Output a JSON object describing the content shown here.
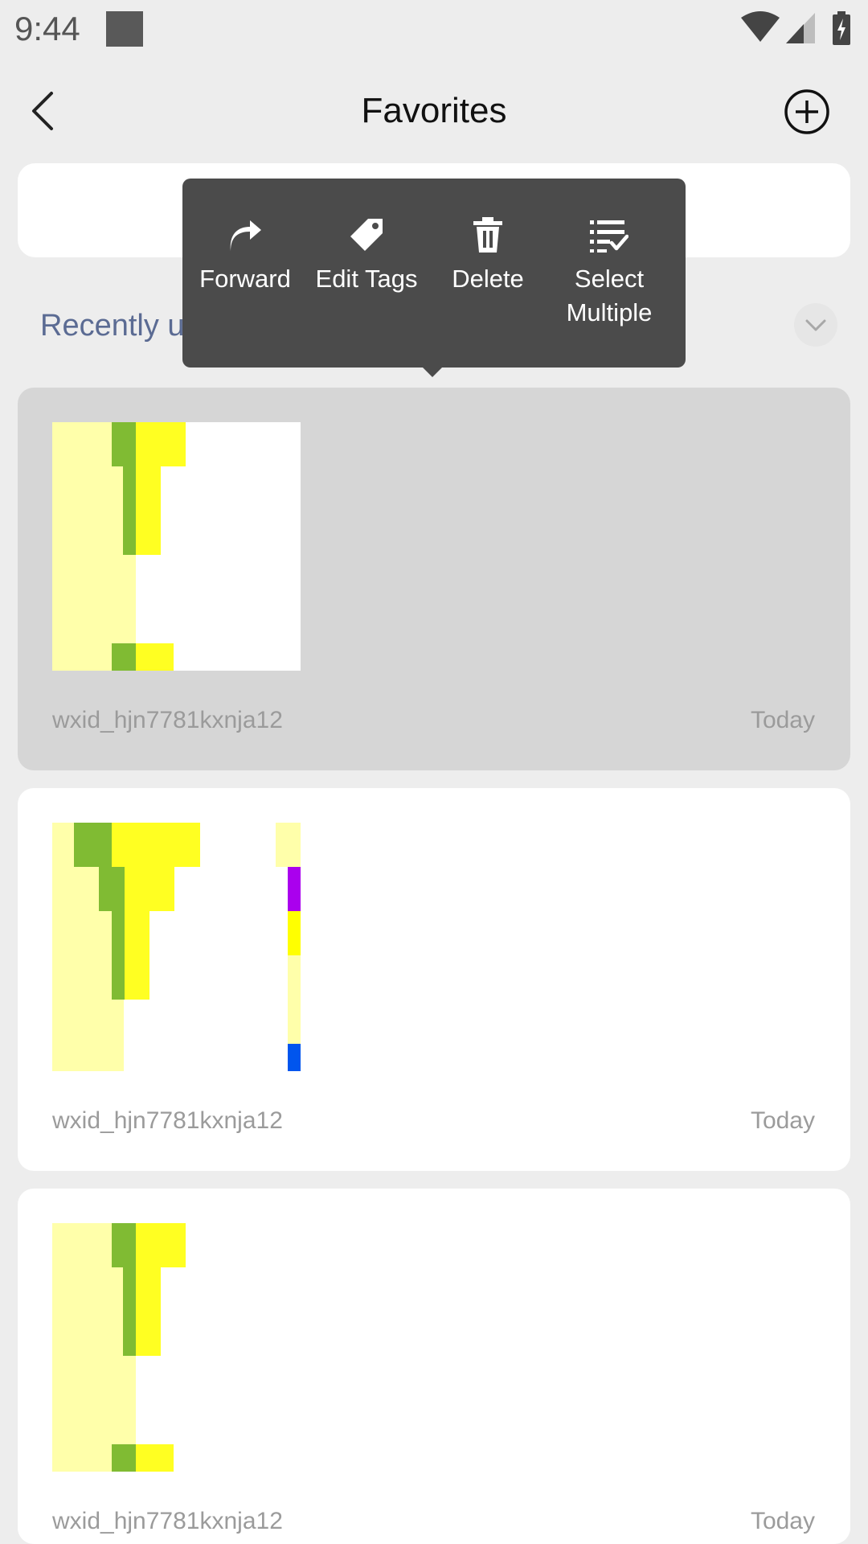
{
  "status_bar": {
    "time": "9:44"
  },
  "header": {
    "title": "Favorites"
  },
  "section": {
    "recently_used_label": "Recently used"
  },
  "context_menu": {
    "items": [
      {
        "label": "Forward",
        "icon": "forward-arrow-icon"
      },
      {
        "label": "Edit Tags",
        "icon": "tag-icon"
      },
      {
        "label": "Delete",
        "icon": "trash-icon"
      },
      {
        "label": "Select\nMultiple",
        "icon": "select-multiple-icon"
      }
    ]
  },
  "favorites": [
    {
      "author": "wxid_hjn7781kxnja12",
      "date": "Today",
      "selected": true
    },
    {
      "author": "wxid_hjn7781kxnja12",
      "date": "Today",
      "selected": false
    },
    {
      "author": "wxid_hjn7781kxnja12",
      "date": "Today",
      "selected": false
    }
  ],
  "colors": {
    "background": "#ededed",
    "menu_bg": "#4b4b4b",
    "accent_label": "#5b6b93",
    "thumb_light_yellow": "#ffffaa",
    "thumb_yellow": "#ffff22",
    "thumb_green": "#80bb33"
  }
}
